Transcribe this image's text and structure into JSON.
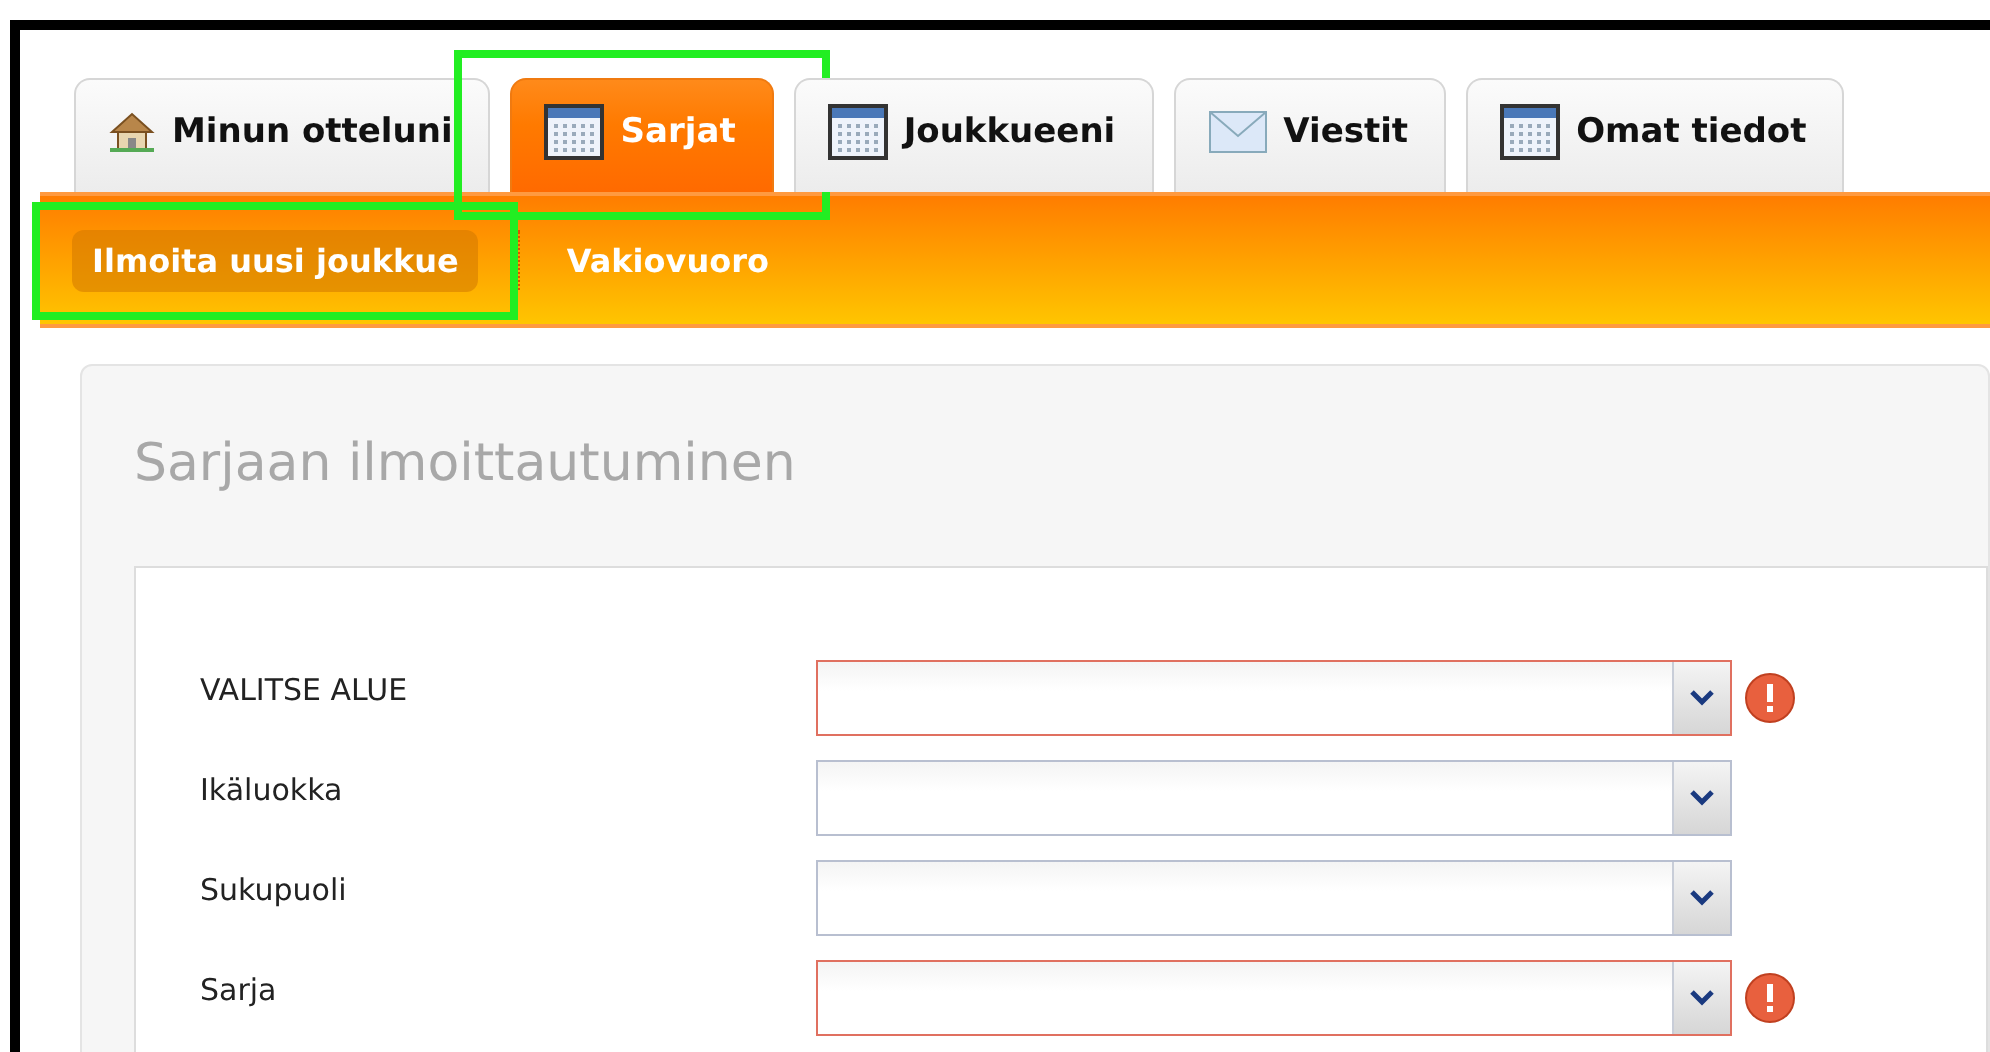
{
  "tabs": [
    {
      "label": "Minun otteluni",
      "kind": "home",
      "selected": false,
      "highlighted": false
    },
    {
      "label": "Sarjat",
      "kind": "calendar",
      "selected": true,
      "highlighted": true
    },
    {
      "label": "Joukkueeni",
      "kind": "calendar",
      "selected": false,
      "highlighted": false
    },
    {
      "label": "Viestit",
      "kind": "mail",
      "selected": false,
      "highlighted": false
    },
    {
      "label": "Omat tiedot",
      "kind": "calendar",
      "selected": false,
      "highlighted": false
    }
  ],
  "subnav": [
    {
      "label": "Ilmoita uusi joukkue",
      "selected": true,
      "highlighted": true
    },
    {
      "label": "Vakiovuoro",
      "selected": false,
      "highlighted": false
    }
  ],
  "panel": {
    "title": "Sarjaan ilmoittautuminen",
    "fields": [
      {
        "label": "VALITSE ALUE",
        "invalid": true
      },
      {
        "label": "Ikäluokka",
        "invalid": false
      },
      {
        "label": "Sukupuoli",
        "invalid": false
      },
      {
        "label": "Sarja",
        "invalid": true
      }
    ]
  }
}
